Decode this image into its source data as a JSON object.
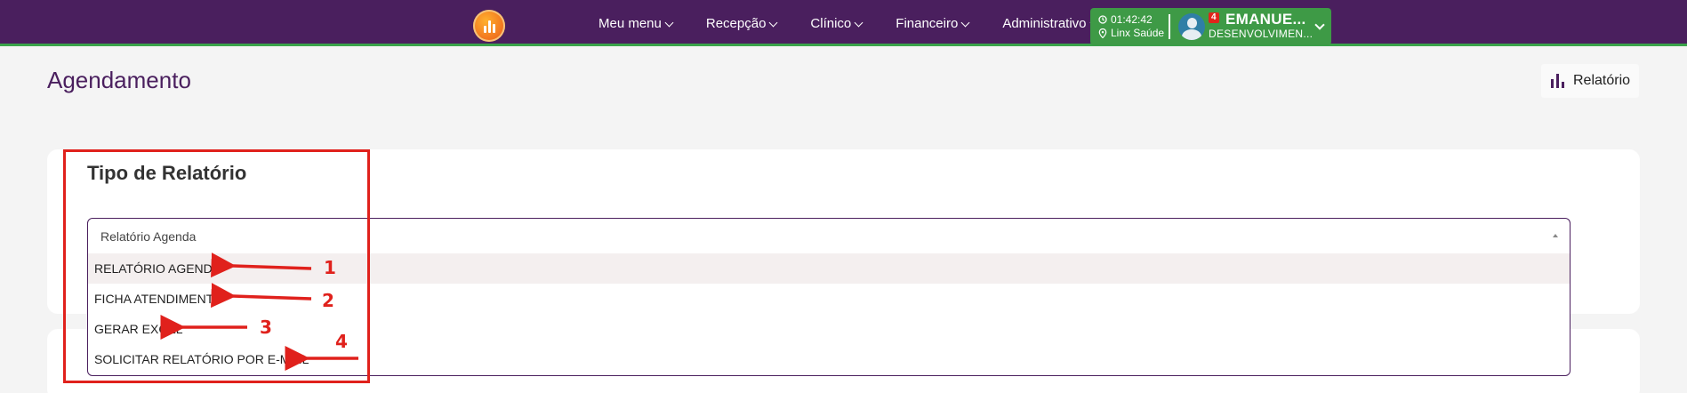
{
  "nav": {
    "items": [
      {
        "label": "Meu menu"
      },
      {
        "label": "Recepção"
      },
      {
        "label": "Clínico"
      },
      {
        "label": "Financeiro"
      },
      {
        "label": "Administrativo"
      }
    ],
    "user": {
      "time": "01:42:42",
      "location": "Linx Saúde",
      "notifications": "4",
      "name": "EMANUE...",
      "department": "DESENVOLVIMEN..."
    }
  },
  "page": {
    "title": "Agendamento",
    "report_button": "Relatório"
  },
  "card": {
    "title": "Tipo de Relatório",
    "select": {
      "selected": "Relatório Agenda",
      "options": [
        {
          "label": "RELATÓRIO AGENDA"
        },
        {
          "label": "FICHA ATENDIMENTO"
        },
        {
          "label": "GERAR EXCEL"
        },
        {
          "label": "SOLICITAR RELATÓRIO POR E-MAIL"
        }
      ]
    }
  },
  "annotations": [
    "1",
    "2",
    "3",
    "4"
  ],
  "colors": {
    "nav_bg": "#4a1f5e",
    "user_box": "#3e9a46",
    "annotation": "#e0211c",
    "accent": "#4a1f5e"
  }
}
